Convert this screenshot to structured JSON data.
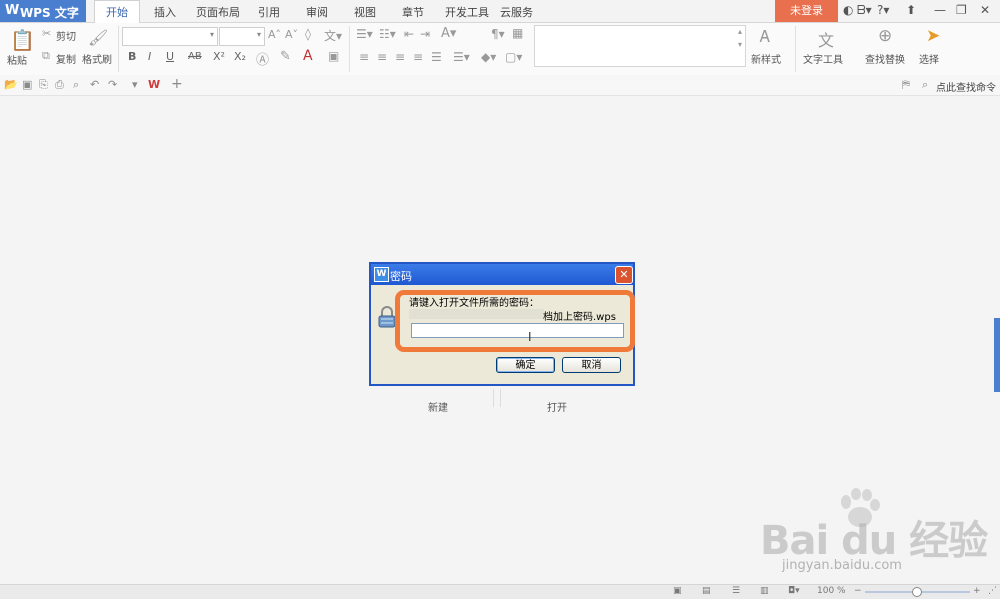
{
  "app": {
    "name": "WPS 文字",
    "caret": "▾",
    "logo": "W"
  },
  "tabs": [
    {
      "label": "开始",
      "active": true
    },
    {
      "label": "插入"
    },
    {
      "label": "页面布局"
    },
    {
      "label": "引用"
    },
    {
      "label": "审阅"
    },
    {
      "label": "视图"
    },
    {
      "label": "章节"
    },
    {
      "label": "开发工具"
    },
    {
      "label": "云服务"
    }
  ],
  "header": {
    "login_label": "未登录",
    "window_controls": [
      "⌄",
      "⬜",
      "—",
      "❐",
      "✕"
    ]
  },
  "ribbon": {
    "paste": "粘贴",
    "cut": "剪切",
    "copy": "复制",
    "format_painter": "格式刷",
    "bold": "B",
    "italic": "I",
    "underline": "U",
    "strike": "AB",
    "superscript": "X²",
    "subscript": "X₂",
    "new_style": "新样式",
    "text_tools": "文字工具",
    "find_replace": "查找替换",
    "select": "选择"
  },
  "quick_access": {
    "search_command": "点此查找命令"
  },
  "dialog": {
    "title": "密码",
    "icon_letter": "W",
    "close": "✕",
    "prompt": "请键入打开文件所需的密码：",
    "file_name": "档加上密码.wps",
    "password_value": "",
    "cursor": "I",
    "ok_label": "确定",
    "cancel_label": "取消"
  },
  "start_page": {
    "new_label": "新建",
    "open_label": "打开"
  },
  "status": {
    "zoom": "100 %",
    "zoom_minus": "−",
    "zoom_plus": "+"
  },
  "watermark": {
    "brand": "Bai du 经验",
    "url": "jingyan.baidu.com"
  },
  "colors": {
    "accent_blue": "#4a7fd0",
    "login_orange": "#e8704f",
    "highlight_orange": "#f07a3a",
    "dialog_title": "#1f58d2"
  }
}
